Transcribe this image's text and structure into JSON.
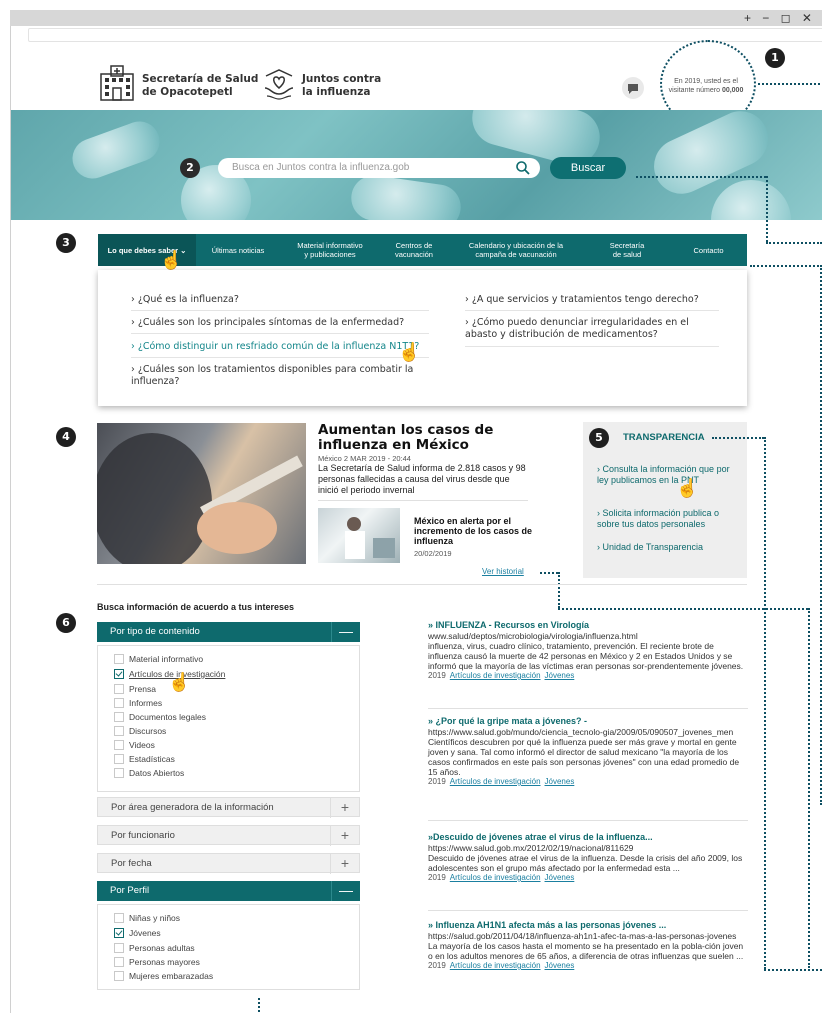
{
  "window": {
    "controls": "+ − ◻ ✕"
  },
  "header": {
    "logo1": {
      "line1": "Secretaría de Salud",
      "line2": "de Opacotepetl"
    },
    "logo2": {
      "line1": "Juntos contra",
      "line2": "la influenza"
    },
    "visitor": {
      "line1": "En 2019, usted es el",
      "line2_prefix": "visitante número",
      "count": "00,000"
    }
  },
  "markers": [
    "1",
    "2",
    "3",
    "4",
    "5",
    "6"
  ],
  "search": {
    "placeholder": "Busca en Juntos contra la influenza.gob",
    "button": "Buscar"
  },
  "nav": {
    "items": [
      "Lo que debes saber ⌄",
      "Últimas noticias",
      "Material informativo\ny publicaciones",
      "Centros de\nvacunación",
      "Calendario y ubicación de la\ncampaña de vacunación",
      "Secretaría\nde salud",
      "Contacto"
    ]
  },
  "dropdown": {
    "left": [
      "› ¿Qué es la influenza?",
      "› ¿Cuáles son los principales síntomas de la enfermedad?",
      "› ¿Cómo distinguir un resfriado común de la influenza N1T1?",
      "› ¿Cuáles son los tratamientos disponibles para combatir la\ninfluenza?"
    ],
    "right": [
      "› ¿A que servicios y tratamientos tengo derecho?",
      "› ¿Cómo puedo denunciar irregularidades en el\nabasto y distribución de medicamentos?"
    ]
  },
  "news": {
    "main_title": "Aumentan los casos de influenza en México",
    "main_meta": "México 2 MAR 2019 - 20:44",
    "main_body": "La Secretaría de Salud informa de 2.818 casos y 98 personas fallecidas a causa del virus desde que inició el periodo invernal",
    "second_title": "México en alerta por el incremento de los casos de influenza",
    "second_date": "20/02/2019",
    "history": "Ver historial"
  },
  "transparency": {
    "title": "TRANSPARENCIA",
    "links": [
      "Consulta la información que por ley publicamos en la PNT",
      "Solicita información publica o sobre tus datos personales",
      "Unidad de Transparencia"
    ]
  },
  "filters": {
    "heading": "Busca información de acuerdo a tus intereses",
    "group1": {
      "label": "Por tipo de contenido",
      "sign": "—",
      "options": [
        {
          "label": "Material informativo",
          "checked": false
        },
        {
          "label": "Artículos de investigación",
          "checked": true
        },
        {
          "label": "Prensa",
          "checked": false
        },
        {
          "label": "Informes",
          "checked": false
        },
        {
          "label": "Documentos legales",
          "checked": false
        },
        {
          "label": "Discursos",
          "checked": false
        },
        {
          "label": "Videos",
          "checked": false
        },
        {
          "label": "Estadísticas",
          "checked": false
        },
        {
          "label": "Datos Abiertos",
          "checked": false
        }
      ]
    },
    "collapsed": [
      {
        "label": "Por área generadora de la información",
        "sign": "+"
      },
      {
        "label": "Por funcionario",
        "sign": "+"
      },
      {
        "label": "Por fecha",
        "sign": "+"
      }
    ],
    "group2": {
      "label": "Por Perfil",
      "sign": "—",
      "options": [
        {
          "label": "Niñas y niños",
          "checked": false
        },
        {
          "label": "Jóvenes",
          "checked": true
        },
        {
          "label": "Personas adultas",
          "checked": false
        },
        {
          "label": "Personas mayores",
          "checked": false
        },
        {
          "label": "Mujeres embarazadas",
          "checked": false
        }
      ]
    }
  },
  "results": [
    {
      "title": "» INFLUENZA - Recursos en Virología",
      "url": "www.salud/deptos/microbiologia/virologia/influenza.html",
      "text": "influenza, virus, cuadro clínico, tratamiento, prevención. El reciente brote de influenza causó la muerte de 42 personas en México y 2 en Estados Unidos y se informó que la mayoría de las víctimas eran personas sor-prendentemente jóvenes.",
      "year": "2019",
      "tag1": "Artículos de investigación",
      "tag2": "Jóvenes"
    },
    {
      "title": "» ¿Por qué la gripe mata a jóvenes? -",
      "url": "https://www.salud.gob/mundo/ciencia_tecnolo-gia/2009/05/090507_jovenes_men",
      "text": "Científicos descubren por qué la influenza puede ser más grave y mortal en gente joven y sana. Tal como informó el director de salud mexicano \"la mayoría de los casos confirmados en este país son personas jóvenes\" con una edad promedio de 15 años.",
      "year": "2019",
      "tag1": "Artículos de investigación",
      "tag2": "Jóvenes"
    },
    {
      "title": "»Descuido de jóvenes atrae el virus de la influenza...",
      "url": "https://www.salud.gob.mx/2012/02/19/nacional/811629",
      "text": "Descuido de jóvenes atrae el virus de la influenza. Desde la crisis del año 2009, los adolescentes son el grupo más afectado por la enfermedad esta ...",
      "year": "2019",
      "tag1": "Artículos de investigación",
      "tag2": "Jóvenes"
    },
    {
      "title": "» Influenza AH1N1 afecta más a las personas jóvenes ...",
      "url": "https://salud.gob/2011/04/18/influenza-ah1n1-afec-ta-mas-a-las-personas-jovenes",
      "text": "La mayoría de los casos hasta el momento se ha presentado en la pobla-ción joven o en los adultos menores de 65 años, a diferencia de otras influenzas que suelen ...",
      "year": "2019",
      "tag1": "Artículos de investigación",
      "tag2": "Jóvenes"
    }
  ]
}
